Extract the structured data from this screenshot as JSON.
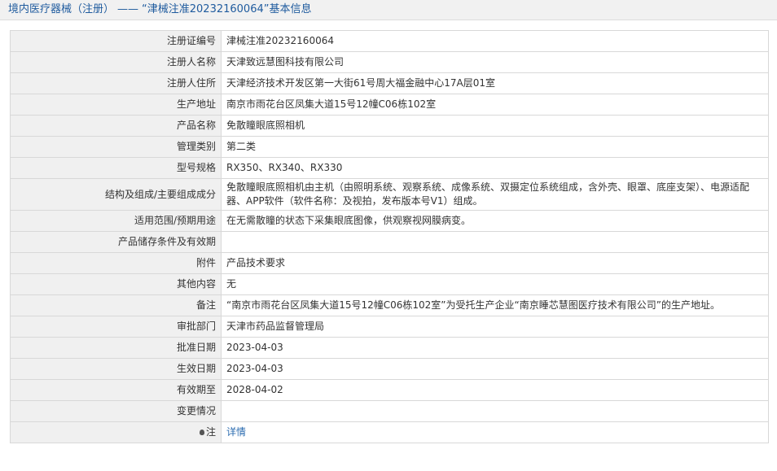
{
  "header": {
    "category": "境内医疗器械（注册）",
    "separator": "——",
    "registration_title": "“津械注准20232160064”",
    "suffix": "基本信息"
  },
  "rows": [
    {
      "label": "注册证编号",
      "value": "津械注准20232160064"
    },
    {
      "label": "注册人名称",
      "value": "天津致远慧图科技有限公司"
    },
    {
      "label": "注册人住所",
      "value": "天津经济技术开发区第一大街61号周大福金融中心17A层01室"
    },
    {
      "label": "生产地址",
      "value": "南京市雨花台区凤集大道15号12幢C06栋102室"
    },
    {
      "label": "产品名称",
      "value": "免散瞳眼底照相机"
    },
    {
      "label": "管理类别",
      "value": "第二类"
    },
    {
      "label": "型号规格",
      "value": "RX350、RX340、RX330"
    },
    {
      "label": "结构及组成/主要组成成分",
      "value": "免散瞳眼底照相机由主机（由照明系统、观察系统、成像系统、双摄定位系统组成，含外壳、眼罩、底座支架）、电源适配器、APP软件（软件名称：及视拍，发布版本号V1）组成。"
    },
    {
      "label": "适用范围/预期用途",
      "value": "在无需散瞳的状态下采集眼底图像，供观察视网膜病变。"
    },
    {
      "label": "产品储存条件及有效期",
      "value": ""
    },
    {
      "label": "附件",
      "value": "产品技术要求"
    },
    {
      "label": "其他内容",
      "value": "无"
    },
    {
      "label": "备注",
      "value": "“南京市雨花台区凤集大道15号12幢C06栋102室”为受托生产企业“南京睡芯慧图医疗技术有限公司”的生产地址。"
    },
    {
      "label": "审批部门",
      "value": "天津市药品监督管理局"
    },
    {
      "label": "批准日期",
      "value": "2023-04-03"
    },
    {
      "label": "生效日期",
      "value": "2023-04-03"
    },
    {
      "label": "有效期至",
      "value": "2028-04-02"
    },
    {
      "label": "变更情况",
      "value": ""
    }
  ],
  "note": {
    "label": "注",
    "link_text": "详情",
    "icon": "bulb-icon"
  }
}
